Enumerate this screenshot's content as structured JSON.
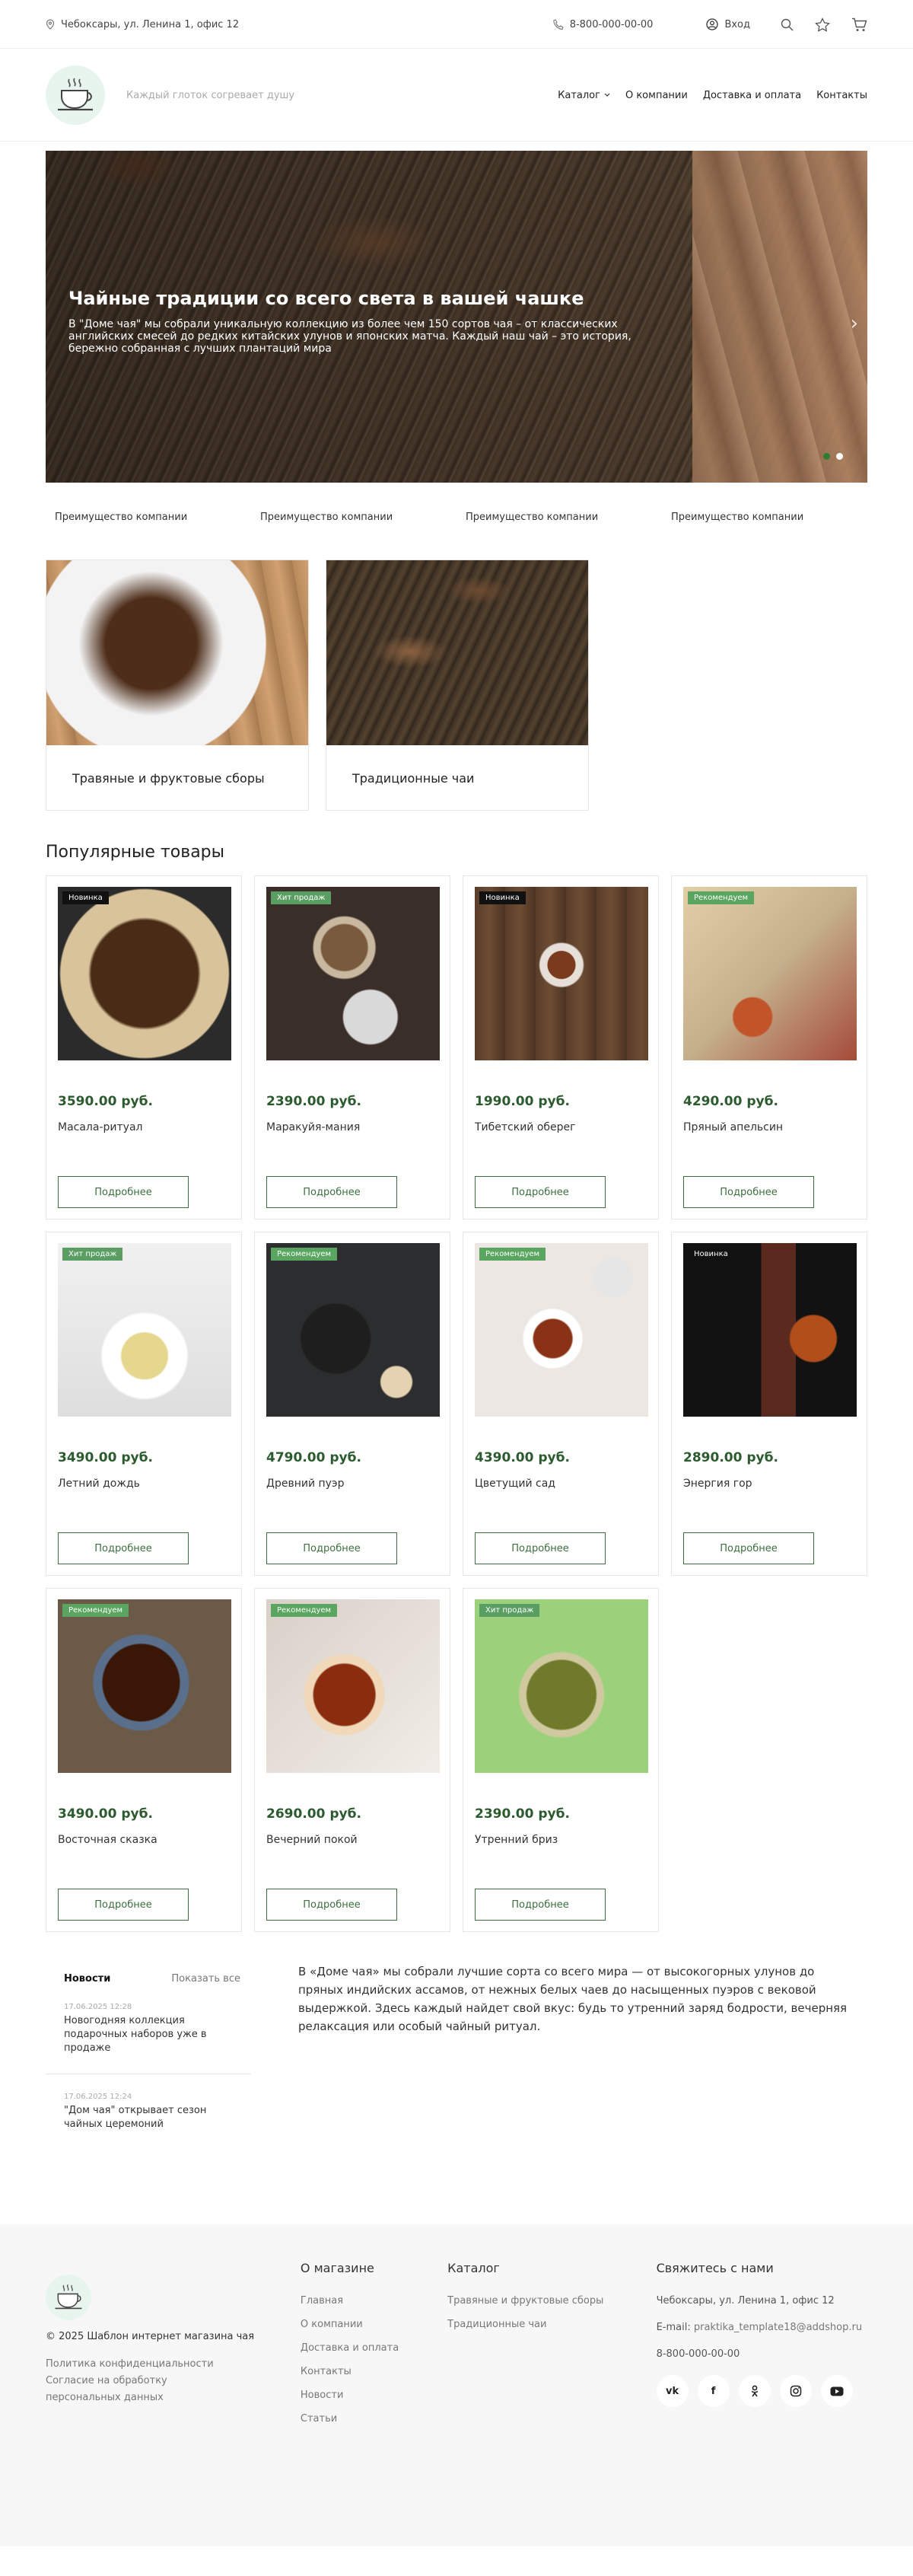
{
  "topbar": {
    "address": "Чебоксары, ул. Ленина 1, офис 12",
    "phone": "8-800-000-00-00",
    "login": "Вход"
  },
  "header": {
    "slogan": "Каждый глоток согревает душу",
    "nav": [
      "Каталог",
      "О компании",
      "Доставка и оплата",
      "Контакты"
    ]
  },
  "hero": {
    "title": "Чайные традиции со всего света в вашей чашке",
    "description": "В \"Доме чая\" мы собрали уникальную коллекцию из более чем 150 сортов чая – от классических английских смесей до редких китайских улунов и японских матча. Каждый наш чай – это история, бережно собранная с лучших плантаций мира",
    "slides_total": 2,
    "active_slide": 1
  },
  "advantages": [
    "Преимущество компании",
    "Преимущество компании",
    "Преимущество компании",
    "Преимущество компании"
  ],
  "categories": [
    {
      "title": "Травяные и фруктовые сборы"
    },
    {
      "title": "Традиционные чаи"
    }
  ],
  "products_section": {
    "title": "Популярные товары",
    "more_label": "Подробнее"
  },
  "products": [
    {
      "name": "Масала-ритуал",
      "price": "3590.00 руб.",
      "badge": "Новинка"
    },
    {
      "name": "Маракуйя-мания",
      "price": "2390.00 руб.",
      "badge": "Хит продаж"
    },
    {
      "name": "Тибетский оберег",
      "price": "1990.00 руб.",
      "badge": "Новинка"
    },
    {
      "name": "Пряный апельсин",
      "price": "4290.00 руб.",
      "badge": "Рекомендуем"
    },
    {
      "name": "Летний дождь",
      "price": "3490.00 руб.",
      "badge": "Хит продаж"
    },
    {
      "name": "Древний пуэр",
      "price": "4790.00 руб.",
      "badge": "Рекомендуем"
    },
    {
      "name": "Цветущий сад",
      "price": "4390.00 руб.",
      "badge": "Рекомендуем"
    },
    {
      "name": "Энергия гор",
      "price": "2890.00 руб.",
      "badge": "Новинка"
    },
    {
      "name": "Восточная сказка",
      "price": "3490.00 руб.",
      "badge": "Рекомендуем"
    },
    {
      "name": "Вечерний покой",
      "price": "2690.00 руб.",
      "badge": "Рекомендуем"
    },
    {
      "name": "Утренний бриз",
      "price": "2390.00 руб.",
      "badge": "Хит продаж"
    }
  ],
  "news": {
    "tab": "Новости",
    "show_all": "Показать все",
    "items": [
      {
        "date": "17.06.2025 12:28",
        "title": "Новогодняя коллекция подарочных наборов уже в продаже"
      },
      {
        "date": "17.06.2025 12:24",
        "title": "\"Дом чая\" открывает сезон чайных церемоний"
      }
    ]
  },
  "about": "В «Доме чая» мы собрали лучшие сорта со всего мира — от высокогорных улунов до пряных индийских ассамов, от нежных белых чаев до насыщенных пуэров с вековой выдержкой. Здесь каждый найдет свой вкус: будь то утренний заряд бодрости, вечерняя релаксация или особый чайный ритуал.",
  "footer": {
    "copyright": "© 2025 Шаблон интернет магазина чая",
    "links": [
      "Политика конфиденциальности",
      "Согласие на обработку персональных данных"
    ],
    "about_title": "О магазине",
    "about_items": [
      "Главная",
      "О компании",
      "Доставка и оплата",
      "Контакты",
      "Новости",
      "Статьи"
    ],
    "catalog_title": "Каталог",
    "catalog_items": [
      "Травяные и фруктовые сборы",
      "Традиционные чаи"
    ],
    "contacts_title": "Свяжитесь с нами",
    "address": "Чебоксары, ул. Ленина 1, офис 12",
    "email_label": "E-mail:",
    "email": "praktika_template18@addshop.ru",
    "phone": "8-800-000-00-00",
    "socials": [
      "vk-icon",
      "facebook-icon",
      "odnoklassniki-icon",
      "instagram-icon",
      "youtube-icon"
    ]
  }
}
